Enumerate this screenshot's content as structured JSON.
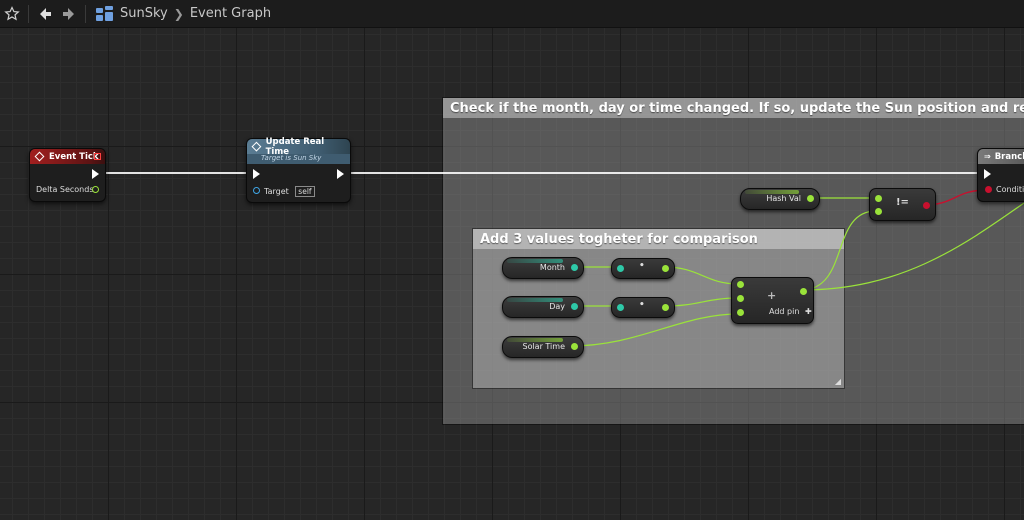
{
  "toolbar": {
    "breadcrumb": [
      "SunSky",
      "Event Graph"
    ]
  },
  "comments": {
    "outer_title": "Check if the month, day or time changed.  If so, update the Sun position and recapture.",
    "inner_title": "Add 3 values togheter for comparison"
  },
  "nodes": {
    "event_tick": {
      "title": "Event Tick",
      "pin_delta": "Delta Seconds"
    },
    "update_real_time": {
      "title": "Update Real Time",
      "subtitle": "Target is Sun Sky",
      "pin_target": "Target",
      "target_value": "self"
    },
    "branch": {
      "title": "Branch",
      "pin_condition": "Condition"
    },
    "hash_val": {
      "label": "Hash Val"
    },
    "not_equal": {
      "symbol": "!="
    },
    "month": {
      "label": "Month"
    },
    "day": {
      "label": "Day"
    },
    "solar_time": {
      "label": "Solar Time"
    },
    "add": {
      "symbol": "+",
      "add_pin": "Add pin"
    },
    "convert_month": {
      "symbol": "•"
    },
    "convert_day": {
      "symbol": "•"
    }
  },
  "colors": {
    "exec_wire": "#ffffff",
    "float_wire": "#9ae33a",
    "bool_wire": "#c8102e",
    "event_header": "#a21f1f",
    "function_header": "#5a7c93"
  }
}
